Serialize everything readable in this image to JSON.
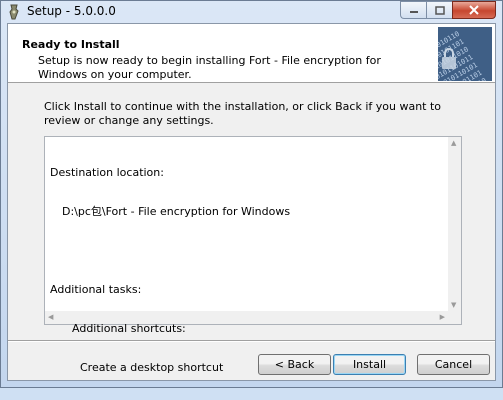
{
  "window": {
    "title": "Setup - 5.0.0.0"
  },
  "header": {
    "title": "Ready to Install",
    "subtitle": "Setup is now ready to begin installing Fort - File encryption for Windows on your computer."
  },
  "intro": "Click Install to continue with the installation, or click Back if you want to review or change any settings.",
  "memo": {
    "dest_heading": "Destination location:",
    "dest_path": "D:\\pc包\\Fort - File encryption for Windows",
    "tasks_heading": "Additional tasks:",
    "shortcuts_heading": "Additional shortcuts:",
    "shortcut_item": "Create a desktop shortcut"
  },
  "buttons": {
    "back": "< Back",
    "install": "Install",
    "cancel": "Cancel"
  },
  "colors": {
    "close_button": "#c7462f",
    "header_bg": "#ffffff",
    "dialog_bg": "#f0f0f0"
  }
}
